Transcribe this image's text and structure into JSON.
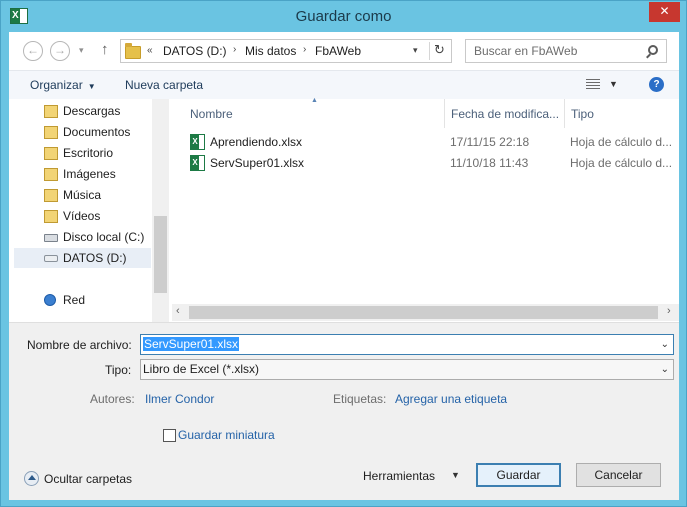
{
  "window": {
    "title": "Guardar como",
    "app_icon_letter": "X",
    "close_label": "✕",
    "accent_color": "#6ac4e2"
  },
  "navigation": {
    "back_icon": "arrow-left-icon",
    "forward_icon": "arrow-right-icon",
    "up_icon": "arrow-up-icon",
    "back_glyph": "←",
    "forward_glyph": "→",
    "up_glyph": "↑",
    "recent_glyph": "▾"
  },
  "address": {
    "overflow": "«",
    "crumbs": [
      "DATOS (D:)",
      "Mis datos",
      "FbAWeb"
    ],
    "separator": "›",
    "dropdown_glyph": "▾",
    "refresh_glyph": "↻"
  },
  "search": {
    "placeholder": "Buscar en FbAWeb"
  },
  "toolbar": {
    "organize": "Organizar",
    "new_folder": "Nueva carpeta",
    "caret": "▼",
    "help": "?"
  },
  "sidebar": {
    "items": [
      {
        "label": "Descargas",
        "icon": "folder-icon"
      },
      {
        "label": "Documentos",
        "icon": "folder-icon"
      },
      {
        "label": "Escritorio",
        "icon": "folder-icon"
      },
      {
        "label": "Imágenes",
        "icon": "folder-icon"
      },
      {
        "label": "Música",
        "icon": "folder-icon"
      },
      {
        "label": "Vídeos",
        "icon": "folder-icon"
      },
      {
        "label": "Disco local (C:)",
        "icon": "drive-icon"
      },
      {
        "label": "DATOS (D:)",
        "icon": "drive-icon",
        "selected": true
      },
      {
        "label": "Red",
        "icon": "network-icon"
      }
    ]
  },
  "files": {
    "columns": [
      "Nombre",
      "Fecha de modifica...",
      "Tipo"
    ],
    "sort_glyph": "▲",
    "rows": [
      {
        "name": "Aprendiendo.xlsx",
        "date": "17/11/15 22:18",
        "type": "Hoja de cálculo d..."
      },
      {
        "name": "ServSuper01.xlsx",
        "date": "11/10/18 11:43",
        "type": "Hoja de cálculo d..."
      }
    ],
    "scroll_left": "‹",
    "scroll_right": "›"
  },
  "form": {
    "filename_label": "Nombre de archivo:",
    "filename_value": "ServSuper01.xlsx",
    "type_label": "Tipo:",
    "type_value": "Libro de Excel (*.xlsx)",
    "authors_label": "Autores:",
    "authors_value": "Ilmer Condor",
    "tags_label": "Etiquetas:",
    "tags_value": "Agregar una etiqueta",
    "thumbnail_label": "Guardar miniatura",
    "thumbnail_checked": false,
    "dropdown_glyph": "⌄"
  },
  "footer": {
    "hide_folders": "Ocultar carpetas",
    "tools": "Herramientas",
    "tools_caret": "▼",
    "save": "Guardar",
    "cancel": "Cancelar"
  }
}
